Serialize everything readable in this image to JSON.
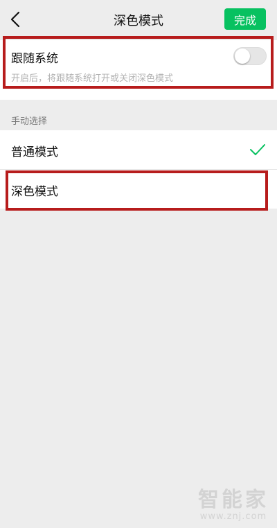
{
  "nav": {
    "title": "深色模式",
    "done_label": "完成"
  },
  "follow_system": {
    "title": "跟随系统",
    "description": "开启后，将跟随系统打开或关闭深色模式",
    "enabled": false
  },
  "manual": {
    "section_label": "手动选择",
    "options": [
      {
        "label": "普通模式",
        "selected": true
      },
      {
        "label": "深色模式",
        "selected": false
      }
    ]
  },
  "watermark": {
    "logo_text": "智能家",
    "url": "www.znj.com"
  },
  "colors": {
    "accent": "#07c160",
    "highlight": "#b71c1c",
    "background": "#ededed"
  },
  "icons": {
    "back": "chevron-left-icon",
    "check": "checkmark-icon"
  }
}
